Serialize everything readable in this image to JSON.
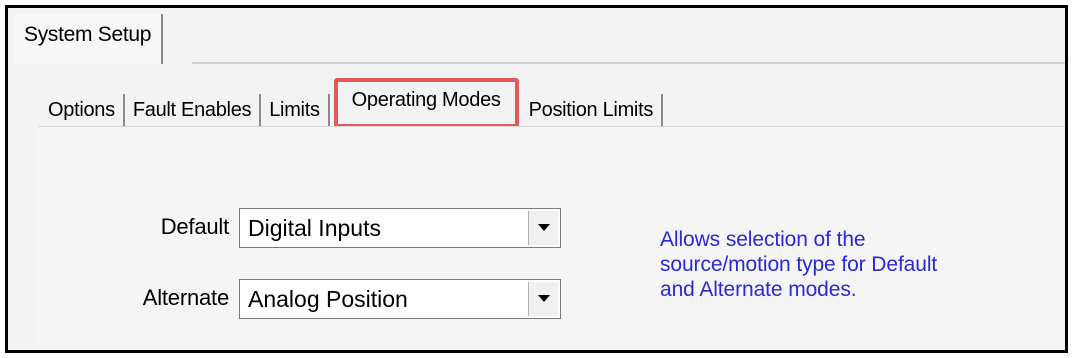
{
  "top_tabs": {
    "system_setup": "System Setup"
  },
  "sub_tabs": [
    {
      "label": "Options"
    },
    {
      "label": "Fault Enables"
    },
    {
      "label": "Limits"
    },
    {
      "label": "Operating Modes",
      "active": true,
      "highlight_color": "#e25a5e"
    },
    {
      "label": "Position Limits"
    }
  ],
  "fields": {
    "default": {
      "label": "Default",
      "value": "Digital Inputs"
    },
    "alternate": {
      "label": "Alternate",
      "value": "Analog Position"
    }
  },
  "help": {
    "line1": "Allows selection of the",
    "line2": "source/motion type for Default",
    "line3": "and Alternate modes.",
    "color": "#2929d6"
  },
  "icons": {
    "dropdown": "chevron-down-icon"
  }
}
